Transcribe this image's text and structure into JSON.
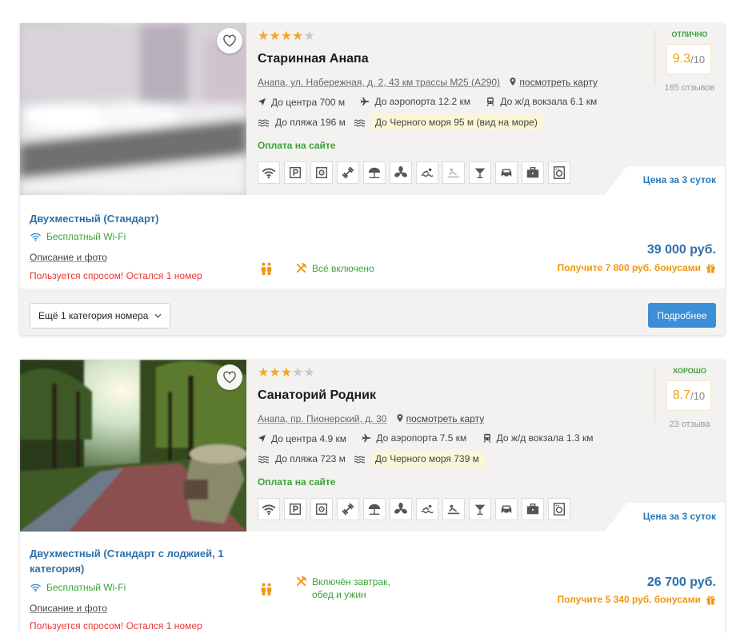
{
  "hotels": [
    {
      "stars_on": "★★★★",
      "stars_off": "★",
      "name": "Старинная Анапа",
      "address": "Анапа, ул. Набережная, д. 2, 43 км трассы М25 (А290)",
      "map_link": "посмотреть карту",
      "to_center": "До центра 700 м",
      "to_airport": "До аэропорта 12.2 км",
      "to_station": "До ж/д вокзала 6.1 км",
      "to_beach": "До пляжа 196 м",
      "to_sea": "До Черного моря 95 м (вид на море)",
      "payment": "Оплата на сайте",
      "rating_label": "отлично",
      "rating_score": "9.3",
      "rating_of": "/10",
      "reviews": "165 отзывов",
      "period": "Цена за 3 суток",
      "room": {
        "name": "Двухместный (Стандарт)",
        "wifi": "Бесплатный Wi-Fi",
        "desc": "Описание и фото",
        "demand": "Пользуется спросом! Остался 1 номер",
        "meal": "Всё включено",
        "price": "39 000 руб.",
        "bonus": "Получите 7 800 руб. бонусами"
      },
      "more_categories": "Ещё 1 категория номера",
      "details_button": "Подробнее"
    },
    {
      "stars_on": "★★★",
      "stars_off": "★★",
      "name": "Санаторий Родник",
      "address": "Анапа, пр. Пионерский, д. 30",
      "map_link": "посмотреть карту",
      "to_center": "До центра 4.9 км",
      "to_airport": "До аэропорта 7.5 км",
      "to_station": "До ж/д вокзала 1.3 км",
      "to_beach": "До пляжа 723 м",
      "to_sea": "До Черного моря 739 м",
      "payment": "Оплата на сайте",
      "rating_label": "хорошо",
      "rating_score": "8.7",
      "rating_of": "/10",
      "reviews": "23 отзыва",
      "period": "Цена за 3 суток",
      "room": {
        "name_line1": "Двухместный (Стандарт с лоджией, 1",
        "name_line2": "категория)",
        "wifi": "Бесплатный Wi-Fi",
        "desc": "Описание и фото",
        "demand": "Пользуется спросом! Остался 1 номер",
        "meal_line1": "Включён завтрак,",
        "meal_line2": "обед и ужин",
        "price": "26 700 руб.",
        "bonus": "Получите 5 340 руб. бонусами"
      }
    }
  ],
  "amenities": [
    "wifi-icon",
    "parking-icon",
    "safe-icon",
    "gym-icon",
    "beach-umbrella-icon",
    "ac-icon",
    "pool-icon",
    "spa-icon",
    "bar-icon",
    "taxi-icon",
    "business-icon",
    "laundry-icon"
  ],
  "colors": {
    "accent_blue": "#2e6fa8",
    "button_blue": "#3b8fd6",
    "green": "#3aa33a",
    "orange": "#f0960f",
    "red": "#e53935",
    "star": "#f5a623"
  }
}
